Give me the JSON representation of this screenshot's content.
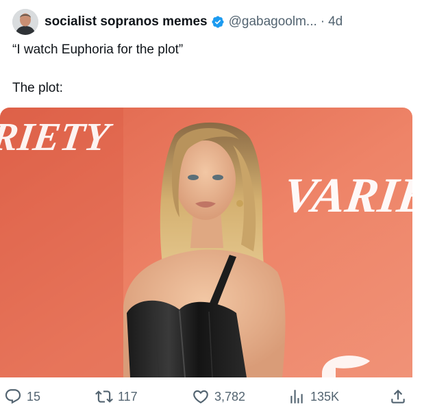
{
  "author": {
    "display_name": "socialist sopranos memes",
    "handle": "@gabagoolm...",
    "separator": "·",
    "time": "4d",
    "verified_color": "#1d9bf0"
  },
  "tweet": {
    "line1": "“I watch Euphoria for the plot”",
    "line2": "The plot:"
  },
  "media": {
    "backdrop_color": "#e8775f",
    "sign_text_top": "RIETY",
    "sign_text_right": "VARIET"
  },
  "actions": {
    "reply_count": "15",
    "retweet_count": "117",
    "like_count": "3,782",
    "views_count": "135K",
    "icons": [
      "reply-icon",
      "retweet-icon",
      "heart-icon",
      "views-icon",
      "share-icon"
    ]
  }
}
